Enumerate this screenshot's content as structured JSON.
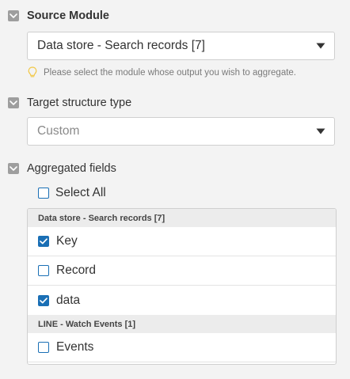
{
  "source_module": {
    "label": "Source Module",
    "selected": "Data store - Search records [7]",
    "hint": "Please select the module whose output you wish to aggregate."
  },
  "target_structure": {
    "label": "Target structure type",
    "selected": "Custom"
  },
  "aggregated_fields": {
    "label": "Aggregated fields",
    "select_all_label": "Select All",
    "select_all_checked": false,
    "groups": [
      {
        "title": "Data store - Search records [7]",
        "fields": [
          {
            "label": "Key",
            "checked": true
          },
          {
            "label": "Record",
            "checked": false
          },
          {
            "label": "data",
            "checked": true
          }
        ]
      },
      {
        "title": "LINE - Watch Events [1]",
        "fields": [
          {
            "label": "Events",
            "checked": false
          }
        ]
      }
    ]
  },
  "colors": {
    "accent": "#1a6fb5",
    "toggle": "#9e9e9e",
    "background": "#f3f3f3",
    "hint_icon": "#f2c744"
  },
  "icons": {
    "section_toggle": "chevron-down-icon",
    "select_caret": "caret-down-icon",
    "hint": "lightbulb-icon",
    "checkbox_checked": "checkmark-icon"
  }
}
